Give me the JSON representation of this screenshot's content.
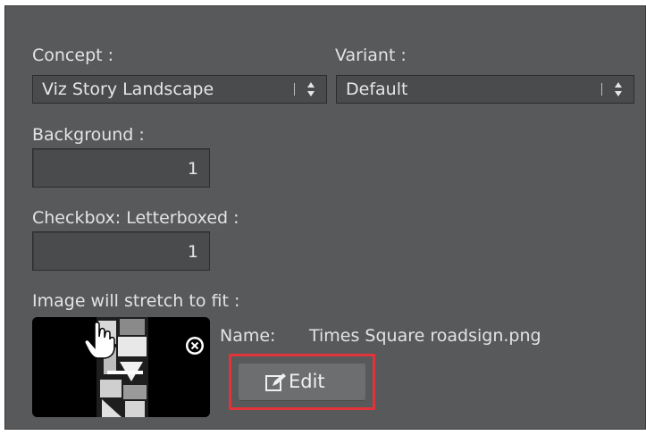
{
  "concept": {
    "label": "Concept :",
    "value": "Viz Story Landscape"
  },
  "variant": {
    "label": "Variant :",
    "value": "Default"
  },
  "background": {
    "label": "Background :",
    "value": "1"
  },
  "letterboxed": {
    "label": "Checkbox: Letterboxed :",
    "value": "1"
  },
  "image": {
    "label": "Image will stretch to fit :",
    "name_label": "Name:",
    "name_value": "Times Square roadsign.png",
    "edit_label": "Edit"
  },
  "colors": {
    "panel_bg": "#58595b",
    "field_bg": "#4a4b4d",
    "text": "#e3e3e3",
    "highlight": "#e0343a"
  },
  "icons": [
    "up-down-arrows-icon",
    "close-icon",
    "edit-icon",
    "hand-cursor-icon"
  ]
}
